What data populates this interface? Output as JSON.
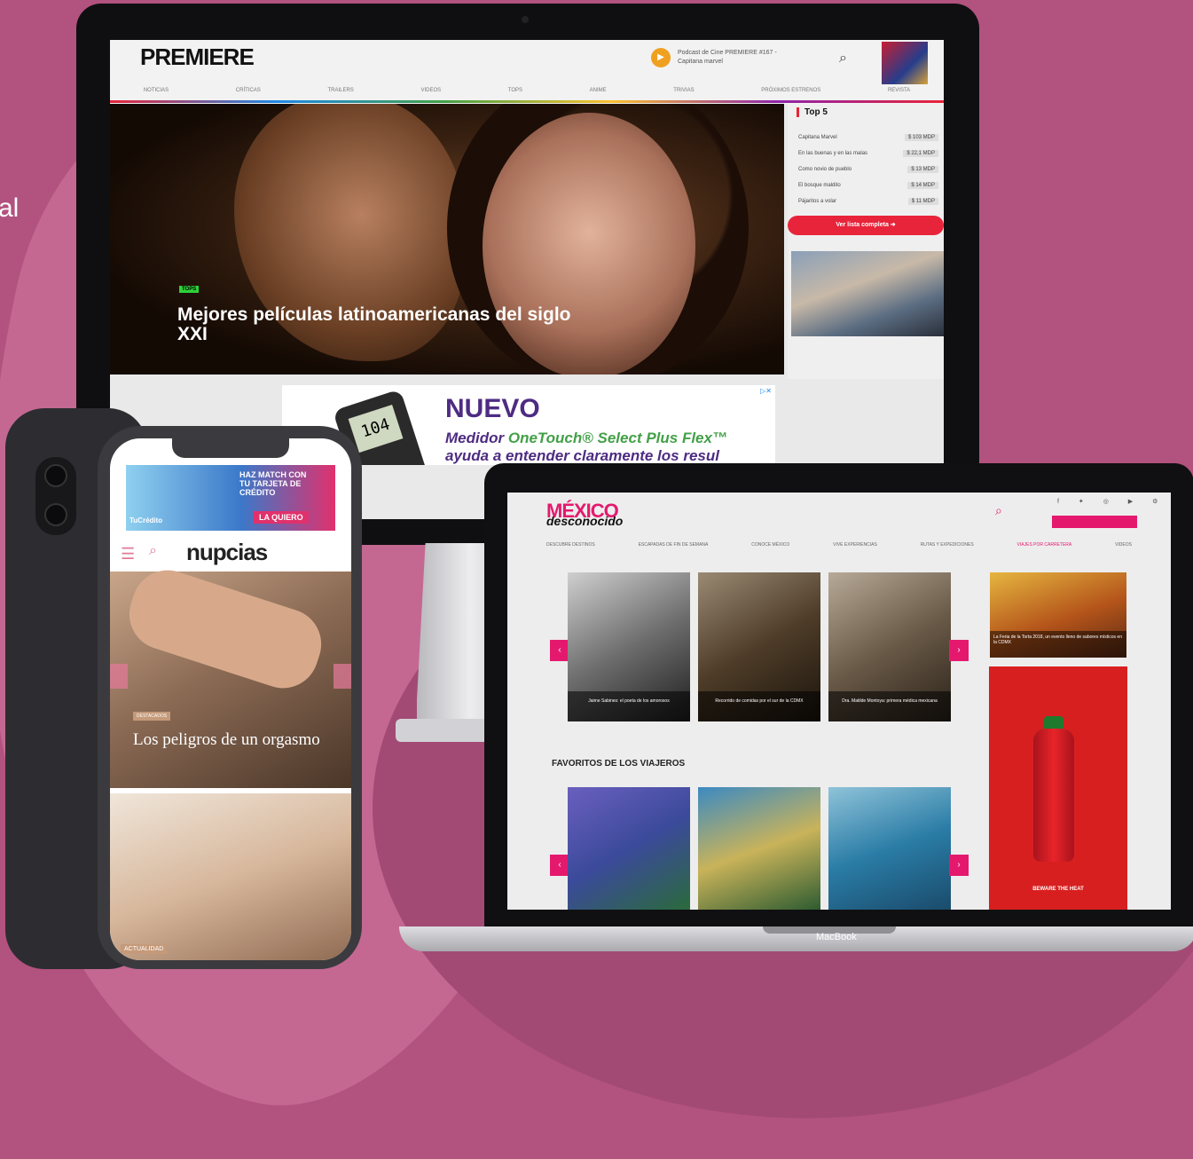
{
  "edge_text": "al",
  "imac": {
    "site": {
      "logo": "PREMIERE",
      "podcast_text": "Podcast de Cine PREMIERE #167 - Capitana marvel",
      "nav": [
        "NOTICIAS",
        "CRÍTICAS",
        "TRAILERS",
        "VIDEOS",
        "TOPS",
        "ANIME",
        "TRIVIAS",
        "PRÓXIMOS ESTRENOS",
        "REVISTA"
      ],
      "hero": {
        "tag": "TOPS",
        "title": "Mejores películas latinoamericanas del siglo XXI",
        "prev": "‹",
        "next": "›"
      },
      "top5": {
        "title": "Top 5",
        "rows": [
          {
            "name": "Capitana Marvel",
            "value": "$ 103 MDP"
          },
          {
            "name": "En las buenas y en las malas",
            "value": "$ 22,1 MDP"
          },
          {
            "name": "Como novio de pueblo",
            "value": "$ 13 MDP"
          },
          {
            "name": "El bosque maldito",
            "value": "$ 14 MDP"
          },
          {
            "name": "Pájaritos a volar",
            "value": "$ 11 MDP"
          }
        ],
        "button": "Ver lista completa ➔"
      },
      "ad": {
        "headline": "NUEVO",
        "line1_pre": "Medidor ",
        "line1_brand": "OneTouch® Select Plus Flex™",
        "line2": "ayuda a entender claramente los resul",
        "device_value": "104"
      }
    }
  },
  "macbook": {
    "label": "MacBook",
    "site": {
      "logo_top": "MÉXICO",
      "logo_bottom": "desconocido",
      "nav": [
        "DESCUBRE DESTINOS",
        "ESCAPADAS DE FIN DE SEMANA",
        "CONOCE MÉXICO",
        "VIVE EXPERIENCIAS",
        "RUTAS Y EXPEDICIONES",
        "VIAJES POR CARRETERA",
        "VIDEOS"
      ],
      "cards": [
        "Jaime Sabines: el poeta de los amorosos",
        "Recorrido de comidas por el sur de la CDMX",
        "Dra. Matilde Montoya: primera médica mexicana"
      ],
      "side_caption": "La Feria de la Torta 2018, un evento lleno de sabores místicos en la CDMX",
      "section_title": "FAVORITOS DE LOS VIAJEROS",
      "ad_text": "BEWARE THE HEAT"
    }
  },
  "iphone": {
    "site": {
      "ad": {
        "text": "HAZ MATCH CON TU TARJETA DE CRÉDITO",
        "button": "LA QUIERO",
        "logo": "TuCrédito"
      },
      "logo": "nupcias",
      "hero": {
        "tag": "DESTACADOS",
        "title": "Los peligros de un orgasmo"
      },
      "card2_tag": "ACTUALIDAD"
    }
  }
}
